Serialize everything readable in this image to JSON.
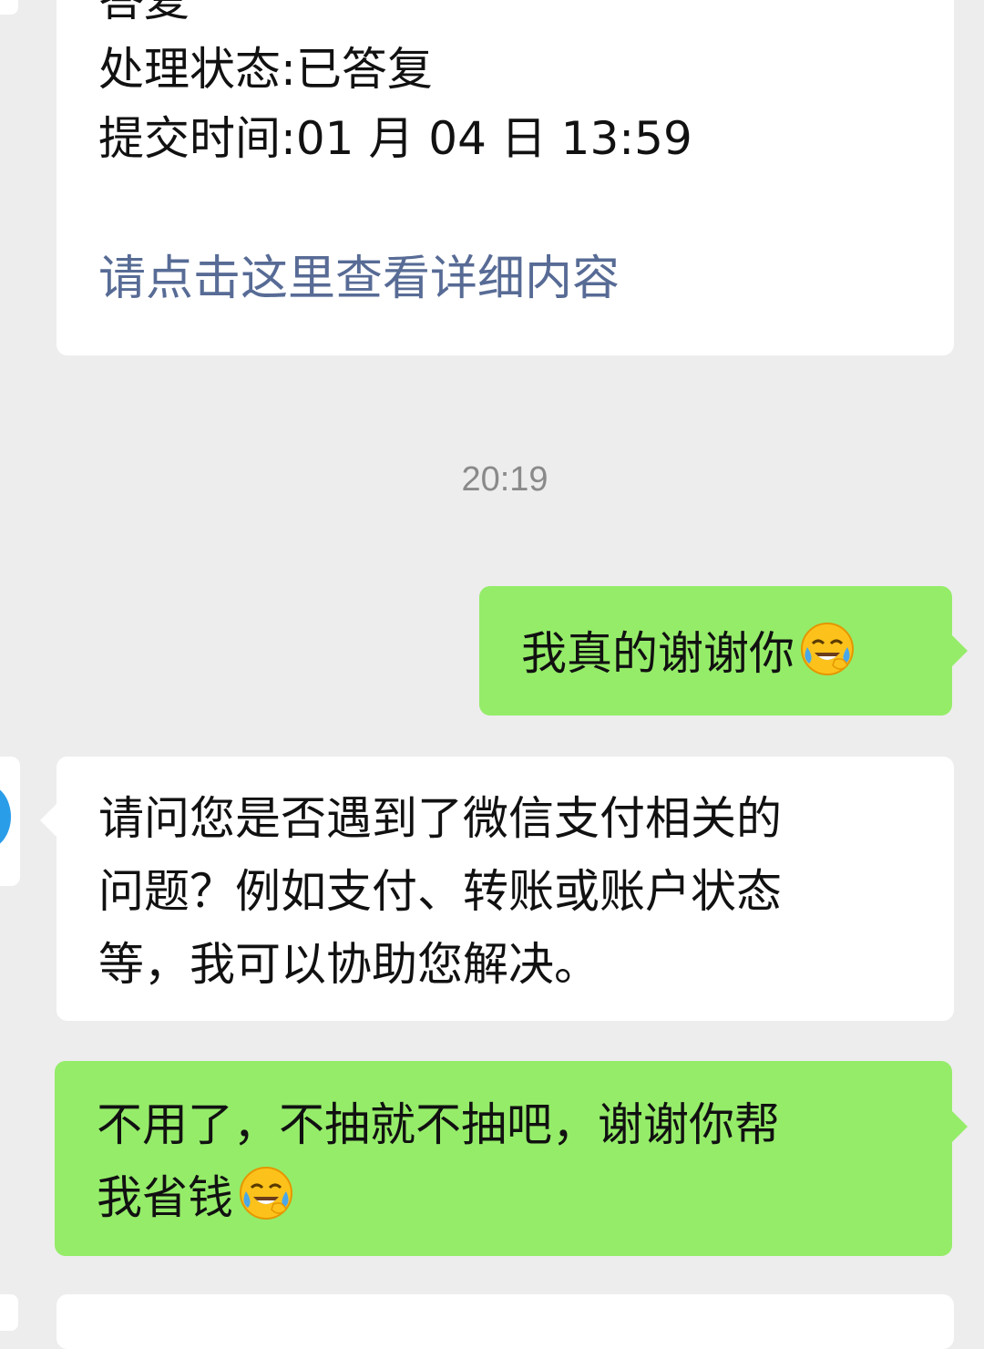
{
  "messages": {
    "card": {
      "line1": "答复",
      "line2": "处理状态:已答复",
      "line3": "提交时间:01 月 04 日 13:59",
      "link": "请点击这里查看详细内容"
    },
    "timestamp": "20:19",
    "sent1": {
      "text": "我真的谢谢你",
      "emoji": "face-with-tears-of-joy-emoji"
    },
    "received1": {
      "line1": "请问您是否遇到了微信支付相关的",
      "line2": "问题？例如支付、转账或账户状态",
      "line3": "等，我可以协助您解决。"
    },
    "sent2": {
      "line1": "不用了，不抽就不抽吧，谢谢你帮",
      "line2": "我省钱",
      "emoji": "face-with-tears-of-joy-emoji"
    }
  },
  "colors": {
    "background": "#ededed",
    "sent_bubble": "#95ec69",
    "received_bubble": "#ffffff",
    "link": "#576b95",
    "timestamp": "#8a8a8a"
  }
}
